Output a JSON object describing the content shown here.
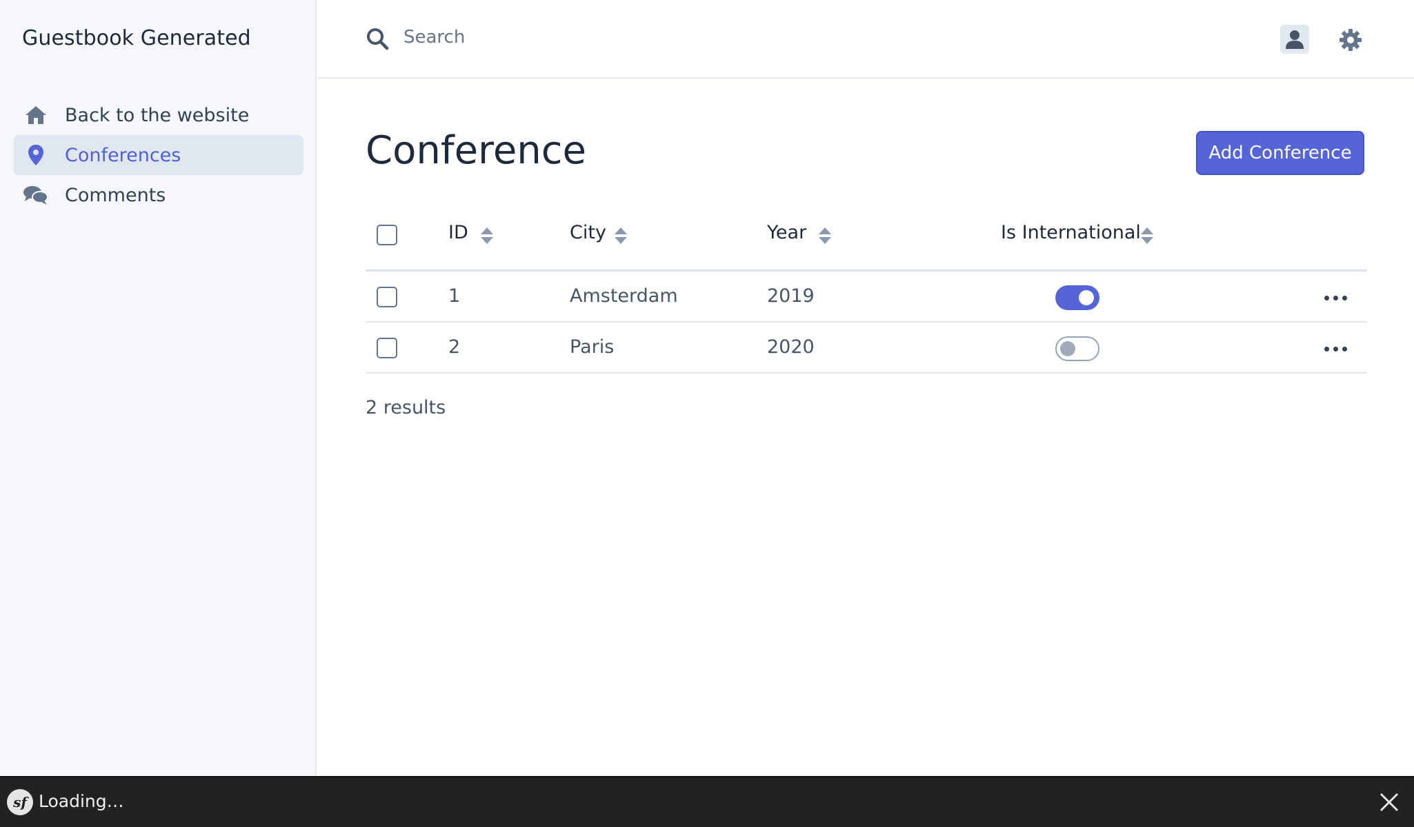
{
  "sidebar": {
    "brand": "Guestbook Generated",
    "items": [
      {
        "label": "Back to the website",
        "icon": "home-icon"
      },
      {
        "label": "Conferences",
        "icon": "map-marker-icon",
        "active": true
      },
      {
        "label": "Comments",
        "icon": "comments-icon"
      }
    ]
  },
  "topbar": {
    "search_placeholder": "Search",
    "search_value": "",
    "user_icon": "user-icon",
    "settings_icon": "gear-icon"
  },
  "main": {
    "title": "Conference",
    "add_button": "Add Conference",
    "columns": [
      "ID",
      "City",
      "Year",
      "Is International"
    ],
    "rows": [
      {
        "id": "1",
        "city": "Amsterdam",
        "year": "2019",
        "is_international": true
      },
      {
        "id": "2",
        "city": "Paris",
        "year": "2020",
        "is_international": false
      }
    ],
    "results_text": "2 results"
  },
  "toolbar": {
    "logo_text": "sf",
    "loading_text": "Loading…"
  },
  "colors": {
    "accent": "#5565d8",
    "sidebar_bg": "#f5f7fa",
    "active_item_bg": "#e0e7f0",
    "toolbar_bg": "#222222"
  }
}
